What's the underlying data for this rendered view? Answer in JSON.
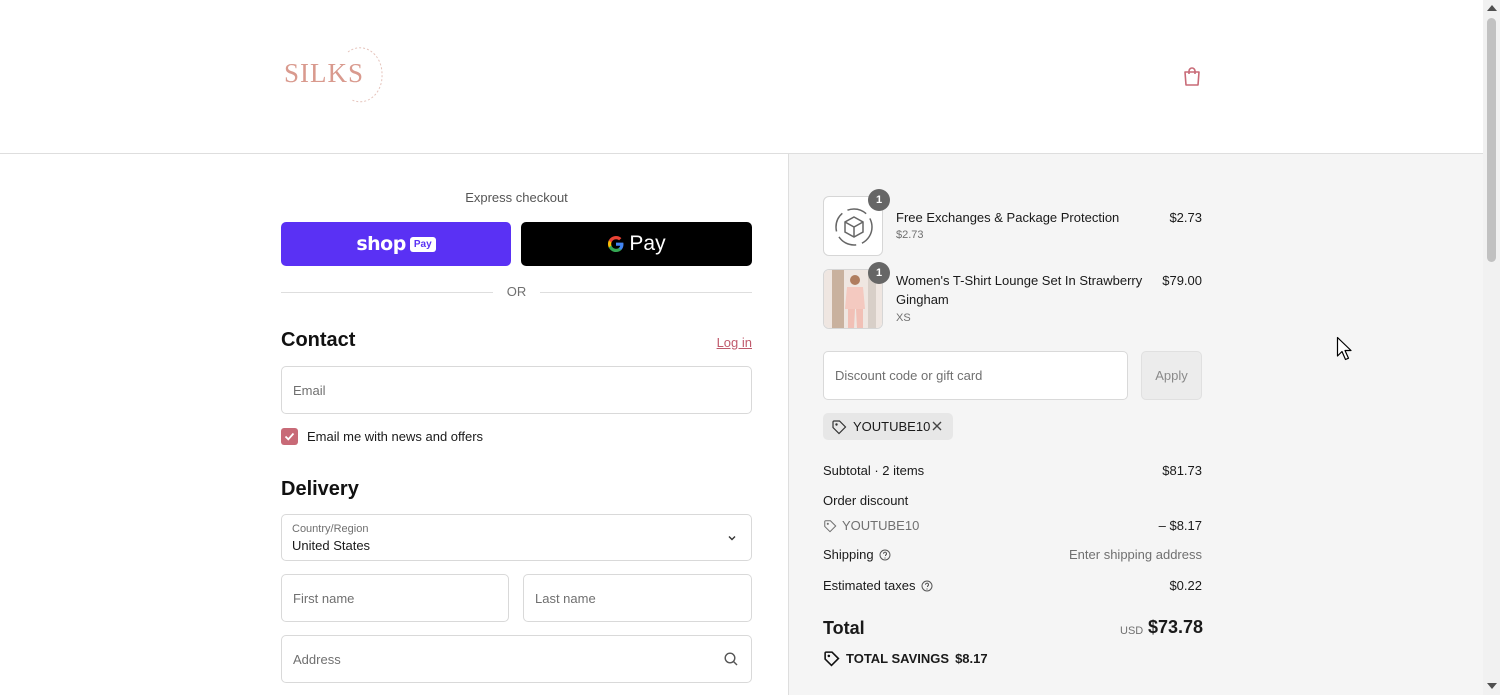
{
  "header": {
    "brand": "SILKS",
    "cart_icon": "shopping-bag-icon"
  },
  "express": {
    "label": "Express checkout",
    "shop_pay": {
      "word": "shop",
      "badge": "Pay",
      "color": "#5a31f4"
    },
    "google_pay": {
      "letter": "G",
      "text": "Pay"
    },
    "or_label": "OR"
  },
  "contact": {
    "title": "Contact",
    "login_label": "Log in",
    "email_placeholder": "Email",
    "newsletter_label": "Email me with news and offers",
    "newsletter_checked": true
  },
  "delivery": {
    "title": "Delivery",
    "country_caption": "Country/Region",
    "country_value": "United States",
    "first_name_placeholder": "First name",
    "last_name_placeholder": "Last name",
    "address_placeholder": "Address"
  },
  "summary": {
    "items": [
      {
        "name": "Free Exchanges & Package Protection",
        "sub": "$2.73",
        "price": "$2.73",
        "qty": "1"
      },
      {
        "name": "Women's T-Shirt Lounge Set In Strawberry Gingham",
        "sub": "XS",
        "price": "$79.00",
        "qty": "1"
      }
    ],
    "discount_placeholder": "Discount code or gift card",
    "apply_label": "Apply",
    "applied_code": "YOUTUBE10",
    "subtotal_label": "Subtotal · 2 items",
    "subtotal_value": "$81.73",
    "order_discount_label": "Order discount",
    "discount_code": "YOUTUBE10",
    "discount_value": "– $8.17",
    "shipping_label": "Shipping",
    "shipping_value": "Enter shipping address",
    "taxes_label": "Estimated taxes",
    "taxes_value": "$0.22",
    "total_label": "Total",
    "total_currency": "USD",
    "total_value": "$73.78",
    "savings_label": "TOTAL SAVINGS",
    "savings_value": "$8.17"
  },
  "colors": {
    "accent": "#c86a77",
    "link": "#c05a6c",
    "summary_bg": "#f5f5f5"
  }
}
